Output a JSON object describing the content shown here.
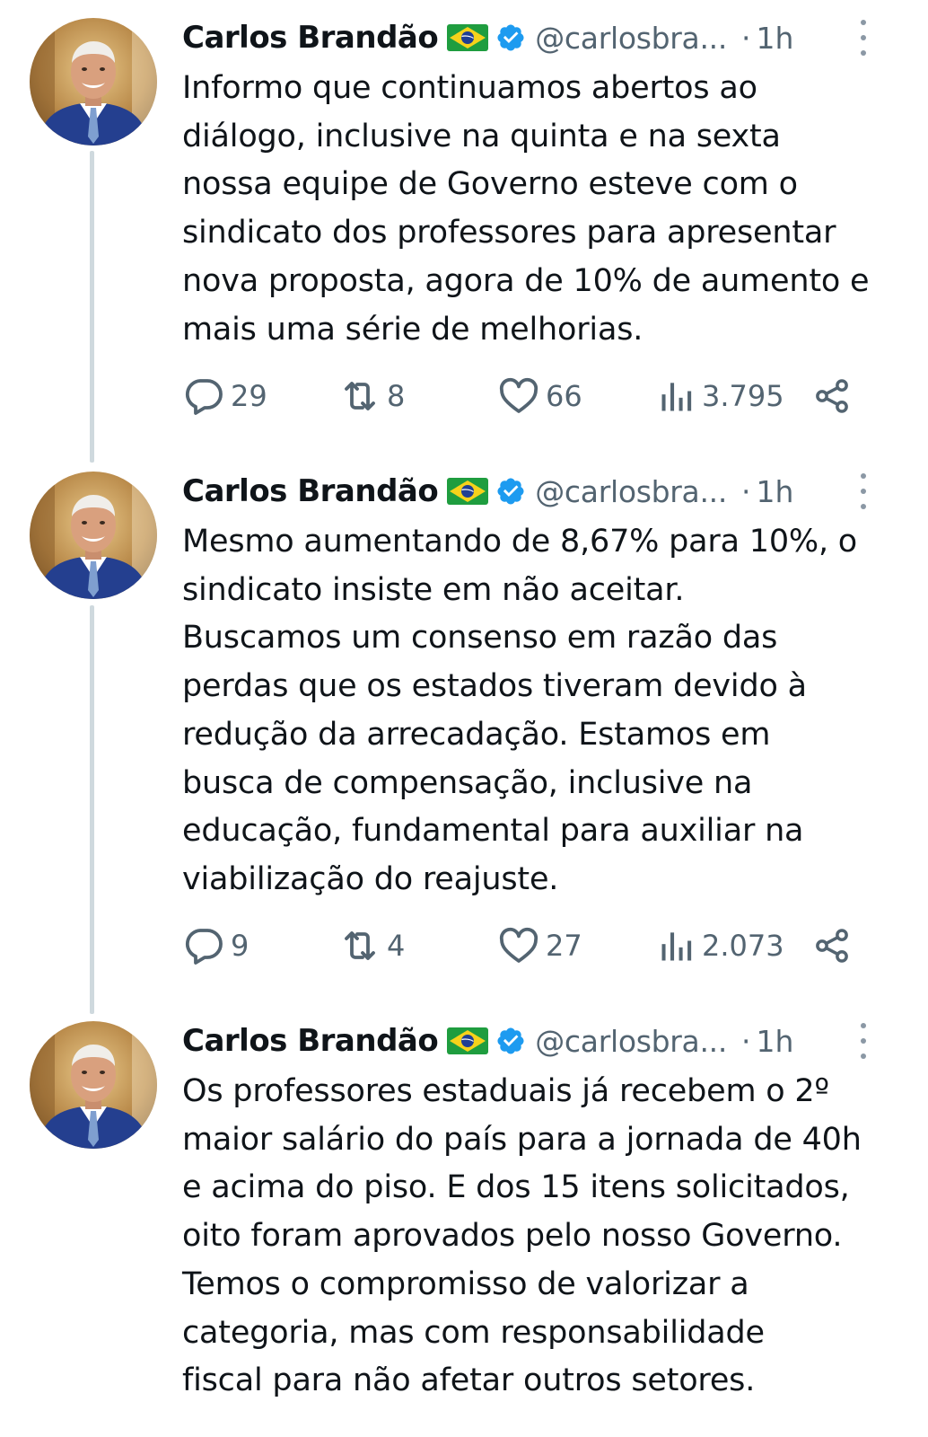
{
  "colors": {
    "text": "#0f1419",
    "secondary": "#536471",
    "verified_blue": "#1d9bf0",
    "thread_line": "#cfd9de"
  },
  "tweets": [
    {
      "author": {
        "name": "Carlos Brandão",
        "flag": "brazil-flag-icon",
        "verified": "verified-badge-icon",
        "handle": "@carlosbra...",
        "separator": "·",
        "time": "1h",
        "avatar": "profile-photo"
      },
      "text_lines": [
        "Informo que continuamos abertos ao",
        "diálogo, inclusive na quinta e na sexta",
        "nossa equipe de Governo esteve com o",
        "sindicato dos professores para apresentar",
        "nova proposta, agora de 10% de aumento e",
        "mais uma série de melhorias."
      ],
      "stats": {
        "replies": "29",
        "retweets": "8",
        "likes": "66",
        "views": "3.795"
      }
    },
    {
      "author": {
        "name": "Carlos Brandão",
        "flag": "brazil-flag-icon",
        "verified": "verified-badge-icon",
        "handle": "@carlosbra...",
        "separator": "·",
        "time": "1h",
        "avatar": "profile-photo"
      },
      "text_lines": [
        "Mesmo aumentando de 8,67% para 10%, o",
        "sindicato insiste em não aceitar.",
        "Buscamos um consenso em razão das",
        "perdas que os estados tiveram devido à",
        "redução da arrecadação. Estamos em",
        "busca de compensação, inclusive na",
        "educação, fundamental para auxiliar na",
        "viabilização do reajuste."
      ],
      "stats": {
        "replies": "9",
        "retweets": "4",
        "likes": "27",
        "views": "2.073"
      }
    },
    {
      "author": {
        "name": "Carlos Brandão",
        "flag": "brazil-flag-icon",
        "verified": "verified-badge-icon",
        "handle": "@carlosbra...",
        "separator": "·",
        "time": "1h",
        "avatar": "profile-photo"
      },
      "text_lines": [
        "Os professores estaduais já recebem o 2º",
        "maior salário do país para a jornada de 40h",
        "e acima do piso. E dos 15 itens solicitados,",
        "oito foram aprovados pelo nosso Governo.",
        "Temos o compromisso de valorizar a",
        "categoria, mas com responsabilidade",
        "fiscal para não afetar outros setores."
      ]
    }
  ]
}
